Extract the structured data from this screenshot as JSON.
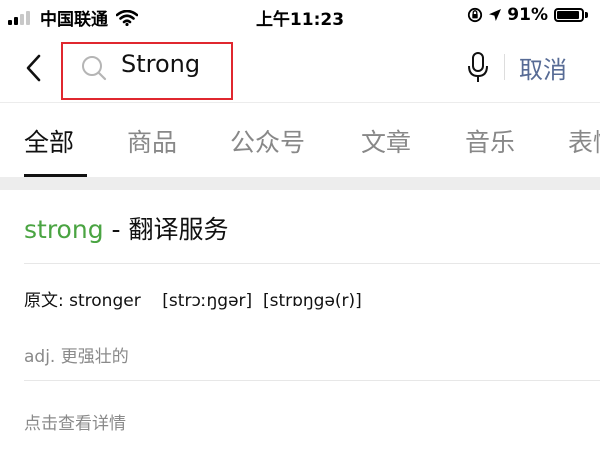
{
  "status_bar": {
    "carrier": "中国联通",
    "time": "上午11:23",
    "battery": "91%",
    "battery_level": 0.91,
    "icons": [
      "signal-icon",
      "wifi-icon",
      "orientation-lock-icon",
      "location-icon",
      "battery-icon"
    ]
  },
  "search": {
    "query": "Strong",
    "cancel_label": "取消",
    "highlight_color": "#e0272f"
  },
  "tabs": [
    {
      "label": "全部",
      "active": true
    },
    {
      "label": "商品",
      "active": false
    },
    {
      "label": "公众号",
      "active": false
    },
    {
      "label": "文章",
      "active": false
    },
    {
      "label": "音乐",
      "active": false
    },
    {
      "label": "表情",
      "active": false
    }
  ],
  "result": {
    "keyword": "strong",
    "title_suffix": " - 翻译服务",
    "original_line": "原文: stronger    [strɔːŋgər]  [strɒŋgə(r)]",
    "meaning": "adj. 更强壮的",
    "detail_link": "点击查看详情"
  },
  "colors": {
    "keyword_green": "#4aa442",
    "cancel_blue": "#576b95",
    "muted_gray": "#8a8a8a"
  }
}
